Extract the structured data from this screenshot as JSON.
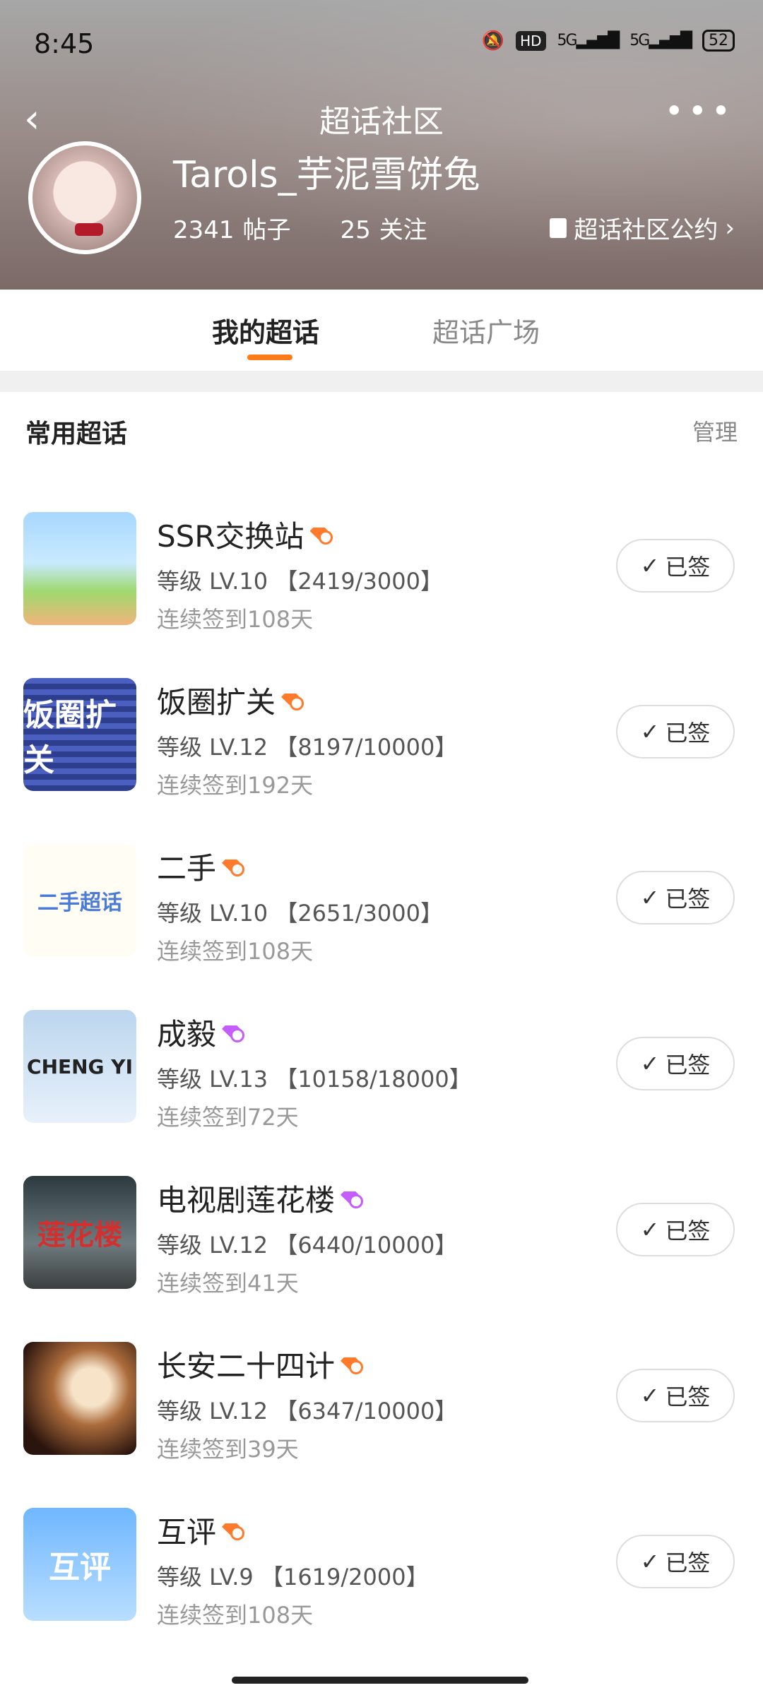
{
  "status_bar": {
    "time": "8:45",
    "hd": "HD",
    "net1": "5G",
    "net2": "5G",
    "battery": "52"
  },
  "header": {
    "title": "超话社区",
    "nickname": "Tarols_芋泥雪饼兔",
    "posts_count": "2341",
    "posts_label": "帖子",
    "follow_count": "25",
    "follow_label": "关注",
    "rules_label": "超话社区公约"
  },
  "tabs": [
    {
      "label": "我的超话",
      "active": true
    },
    {
      "label": "超话广场",
      "active": false
    }
  ],
  "section": {
    "title": "常用超话",
    "manage_label": "管理"
  },
  "items": [
    {
      "name": "SSR交换站",
      "level": "等级 LV.10 【2419/3000】",
      "streak": "连续签到108天",
      "button": "已签",
      "gem": "orange"
    },
    {
      "name": "饭圈扩关",
      "level": "等级 LV.12 【8197/10000】",
      "streak": "连续签到192天",
      "button": "已签",
      "gem": "orange"
    },
    {
      "name": "二手",
      "level": "等级 LV.10 【2651/3000】",
      "streak": "连续签到108天",
      "button": "已签",
      "gem": "orange"
    },
    {
      "name": "成毅",
      "level": "等级 LV.13 【10158/18000】",
      "streak": "连续签到72天",
      "button": "已签",
      "gem": "purple"
    },
    {
      "name": "电视剧莲花楼",
      "level": "等级 LV.12 【6440/10000】",
      "streak": "连续签到41天",
      "button": "已签",
      "gem": "purple"
    },
    {
      "name": "长安二十四计",
      "level": "等级 LV.12 【6347/10000】",
      "streak": "连续签到39天",
      "button": "已签",
      "gem": "orange"
    },
    {
      "name": "互评",
      "level": "等级 LV.9 【1619/2000】",
      "streak": "连续签到108天",
      "button": "已签",
      "gem": "orange"
    }
  ],
  "thumb_text": {
    "t2": "饭圈扩关",
    "t3": "二手超话",
    "t4": "CHENG YI",
    "t5": "莲花楼",
    "t7": "互评"
  }
}
